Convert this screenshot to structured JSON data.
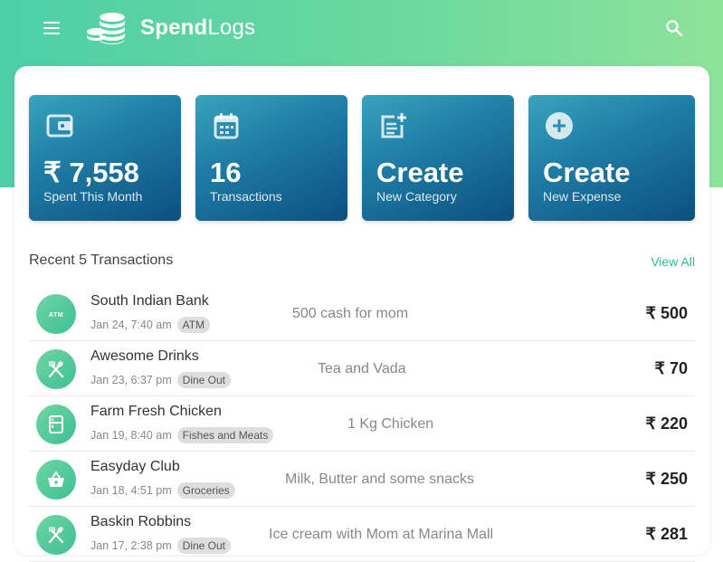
{
  "header": {
    "brand_bold": "Spend",
    "brand_light": "Logs",
    "menu_icon": "hamburger-menu-icon",
    "search_icon": "search-icon",
    "logo_icon": "coin-stack-icon"
  },
  "tiles": [
    {
      "icon": "wallet-icon",
      "value": "₹ 7,558",
      "label": "Spent This Month"
    },
    {
      "icon": "calendar-icon",
      "value": "16",
      "label": "Transactions"
    },
    {
      "icon": "post-add-icon",
      "value": "Create",
      "label": "New Category"
    },
    {
      "icon": "add-circle-icon",
      "value": "Create",
      "label": "New Expense"
    }
  ],
  "recent": {
    "title": "Recent 5 Transactions",
    "view_all": "View All"
  },
  "transactions": [
    {
      "merchant": "South Indian Bank",
      "time": "Jan 24, 7:40 am",
      "category": "ATM",
      "note": "500 cash for mom",
      "amount": "₹ 500",
      "icon": "atm-icon"
    },
    {
      "merchant": "Awesome Drinks",
      "time": "Jan 23, 6:37 pm",
      "category": "Dine Out",
      "note": "Tea and Vada",
      "amount": "₹ 70",
      "icon": "restaurant-icon"
    },
    {
      "merchant": "Farm Fresh Chicken",
      "time": "Jan 19, 8:40 am",
      "category": "Fishes and Meats",
      "note": "1 Kg Chicken",
      "amount": "₹ 220",
      "icon": "fridge-icon"
    },
    {
      "merchant": "Easyday Club",
      "time": "Jan 18, 4:51 pm",
      "category": "Groceries",
      "note": "Milk, Butter and some snacks",
      "amount": "₹ 250",
      "icon": "shopping-basket-icon"
    },
    {
      "merchant": "Baskin Robbins",
      "time": "Jan 17, 2:38 pm",
      "category": "Dine Out",
      "note": "Ice cream with Mom at Marina Mall",
      "amount": "₹ 281",
      "icon": "restaurant-icon"
    }
  ],
  "colors": {
    "header_gradient_start": "#4dcfa8",
    "header_gradient_end": "#8ee39a",
    "tile_gradient_start": "#3aa3bd",
    "tile_gradient_end": "#0c4f7e",
    "accent": "#2fbf95"
  }
}
